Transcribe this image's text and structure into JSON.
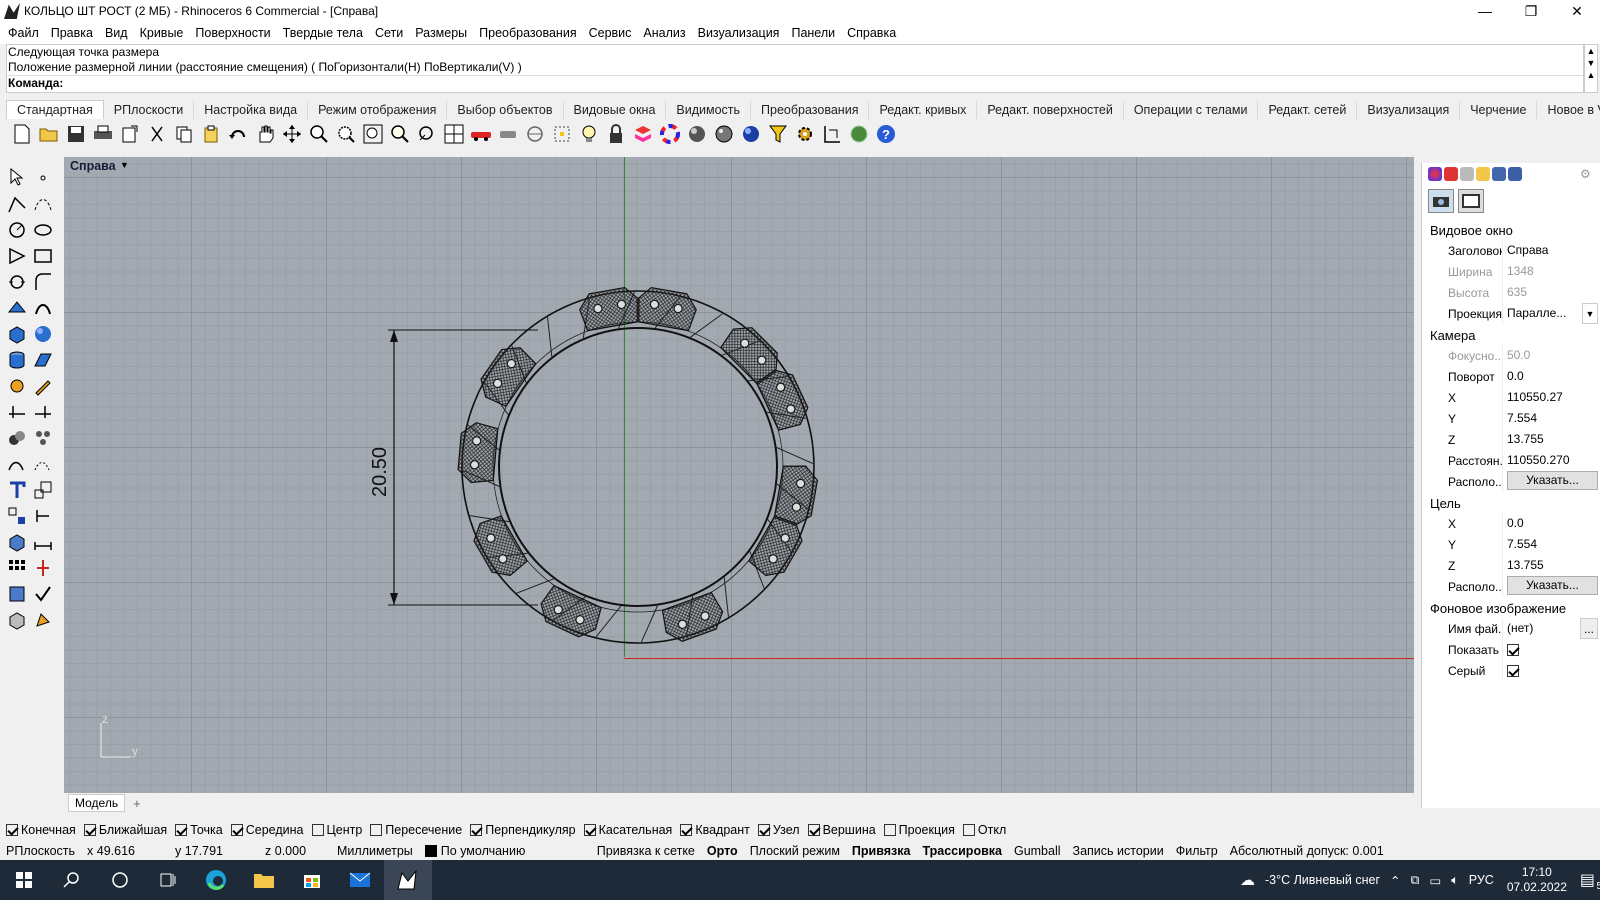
{
  "window": {
    "title": "КОЛЬЦО ШТ РОСТ (2 МБ) - Rhinoceros 6 Commercial - [Справа]",
    "minimize": "—",
    "maximize": "❐",
    "close": "✕"
  },
  "menu": [
    "Файл",
    "Правка",
    "Вид",
    "Кривые",
    "Поверхности",
    "Твердые тела",
    "Сети",
    "Размеры",
    "Преобразования",
    "Сервис",
    "Анализ",
    "Визуализация",
    "Панели",
    "Справка"
  ],
  "command": {
    "line1": "Следующая точка размера",
    "line2": "Положение размерной линии (расстояние смещения) ( ПоГоризонтали(H)  ПоВертикали(V) )",
    "prompt": "Команда:"
  },
  "toolbar_tabs": [
    "Стандартная",
    "РПлоскости",
    "Настройка вида",
    "Режим отображения",
    "Выбор объектов",
    "Видовые окна",
    "Видимость",
    "Преобразования",
    "Редакт. кривых",
    "Редакт. поверхностей",
    "Операции с телами",
    "Редакт. сетей",
    "Визуализация",
    "Черчение",
    "Новое в V6"
  ],
  "active_tab": "Стандартная",
  "toolbar_icons": [
    "new-file-icon",
    "open-icon",
    "save-icon",
    "print-icon",
    "export-icon",
    "cut-icon",
    "copy-icon",
    "paste-icon",
    "undo-icon",
    "pan-hand-icon",
    "rotate-view-icon",
    "zoom-icon",
    "zoom-window-icon",
    "zoom-extents-icon",
    "zoom-selected-icon",
    "zoom-rotate-icon",
    "four-viewports-icon",
    "car-icon",
    "show-objects-icon",
    "lock-circle-icon",
    "snap-grid-icon",
    "light-icon",
    "lock-icon",
    "layer-icon",
    "color-wheel-icon",
    "sphere-gray-icon",
    "sphere-shaded-icon",
    "sphere-blue-icon",
    "filter-icon",
    "gear-icon",
    "dimension-icon",
    "globe-icon",
    "help-icon"
  ],
  "viewport": {
    "title": "Справа",
    "dimension_label": "20.50",
    "axis_z": "z",
    "axis_y": "y",
    "axis_colors": {
      "x": "#cc2222",
      "z": "#2e8b2e"
    }
  },
  "model_tabs": {
    "model": "Модель",
    "add": "+"
  },
  "panel": {
    "section_viewport": "Видовое окно",
    "rows_viewport": [
      {
        "k": "Заголовок",
        "v": "Справа",
        "dis": false
      },
      {
        "k": "Ширина",
        "v": "1348",
        "dis": true
      },
      {
        "k": "Высота",
        "v": "635",
        "dis": true
      },
      {
        "k": "Проекция",
        "v": "Паралле...",
        "dis": false
      }
    ],
    "section_camera": "Камера",
    "rows_camera": [
      {
        "k": "Фокусно...",
        "v": "50.0",
        "dis": true
      },
      {
        "k": "Поворот",
        "v": "0.0",
        "dis": false
      },
      {
        "k": "X",
        "v": "110550.27",
        "dis": false
      },
      {
        "k": "Y",
        "v": "7.554",
        "dis": false
      },
      {
        "k": "Z",
        "v": "13.755",
        "dis": false
      },
      {
        "k": "Расстоян...",
        "v": "110550.270",
        "dis": false
      }
    ],
    "camera_place_label": "Располо...",
    "camera_place_button": "Указать...",
    "section_target": "Цель",
    "rows_target": [
      {
        "k": "X",
        "v": "0.0",
        "dis": false
      },
      {
        "k": "Y",
        "v": "7.554",
        "dis": false
      },
      {
        "k": "Z",
        "v": "13.755",
        "dis": false
      }
    ],
    "target_place_label": "Располо...",
    "target_place_button": "Указать...",
    "section_background": "Фоновое изображение",
    "file_label": "Имя фай...",
    "file_value": "(нет)",
    "file_button": "...",
    "show_label": "Показать",
    "gray_label": "Серый"
  },
  "osnaps": [
    {
      "label": "Конечная",
      "on": true
    },
    {
      "label": "Ближайшая",
      "on": true
    },
    {
      "label": "Точка",
      "on": true
    },
    {
      "label": "Середина",
      "on": true
    },
    {
      "label": "Центр",
      "on": false
    },
    {
      "label": "Пересечение",
      "on": false
    },
    {
      "label": "Перпендикуляр",
      "on": true
    },
    {
      "label": "Касательная",
      "on": true
    },
    {
      "label": "Квадрант",
      "on": true
    },
    {
      "label": "Узел",
      "on": true
    },
    {
      "label": "Вершина",
      "on": true
    },
    {
      "label": "Проекция",
      "on": false
    },
    {
      "label": "Откл",
      "on": false
    }
  ],
  "status": {
    "cplane": "РПлоскость",
    "x": "x 49.616",
    "y": "y 17.791",
    "z": "z 0.000",
    "units": "Миллиметры",
    "layer": "По умолчанию",
    "grid_snap": "Привязка к сетке",
    "ortho": "Орто",
    "planar": "Плоский режим",
    "osnap": "Привязка",
    "smarttrack": "Трассировка",
    "gumball": "Gumball",
    "history": "Запись истории",
    "filter": "Фильтр",
    "tolerance": "Абсолютный допуск: 0.001"
  },
  "taskbar": {
    "weather": "-3°C  Ливневый снег",
    "lang": "РУС",
    "time": "17:10",
    "date": "07.02.2022",
    "notifications": "5"
  }
}
